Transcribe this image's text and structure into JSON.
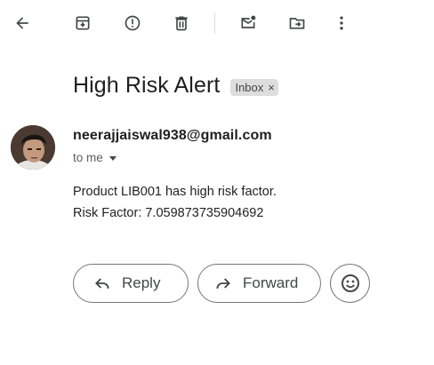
{
  "toolbar": {
    "icons": [
      "back-arrow-icon",
      "archive-icon",
      "report-spam-icon",
      "delete-icon",
      "mark-unread-icon",
      "move-to-icon",
      "more-vert-icon"
    ]
  },
  "email": {
    "subject": "High Risk Alert",
    "label": "Inbox",
    "label_remove": "×",
    "sender": "neerajjaiswal938@gmail.com",
    "recipient": "to me",
    "body_line1": "Product LIB001 has high risk factor.",
    "body_line2": "Risk Factor: 7.059873735904692"
  },
  "actions": {
    "reply_label": "Reply",
    "forward_label": "Forward"
  },
  "colors": {
    "icon": "#444746",
    "chip_bg": "#dddddd",
    "text": "#1f1f1f",
    "button_border": "#747775"
  }
}
